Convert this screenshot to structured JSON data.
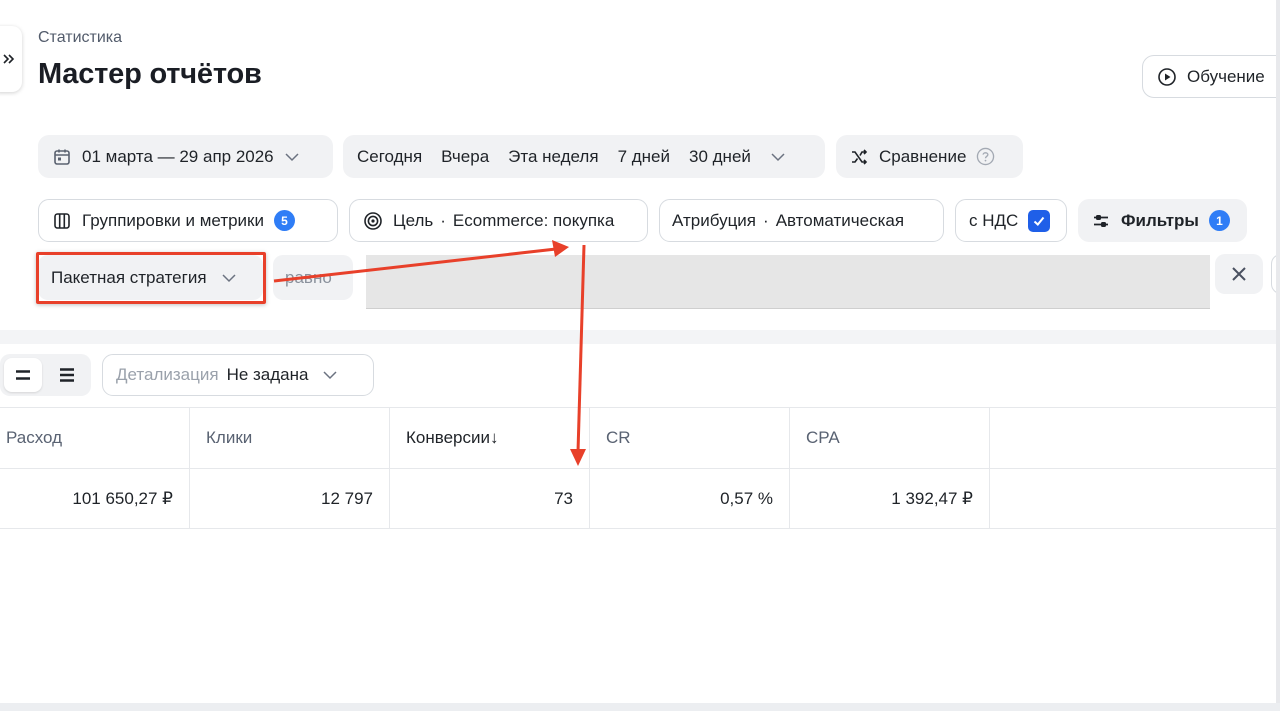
{
  "header": {
    "breadcrumb": "Статистика",
    "title": "Мастер отчётов",
    "tutorial_label": "Обучение"
  },
  "period": {
    "date_range": "01 марта — 29 апр 2026",
    "quick_ranges": [
      "Сегодня",
      "Вчера",
      "Эта неделя",
      "7 дней",
      "30 дней"
    ],
    "compare_label": "Сравнение"
  },
  "settings": {
    "groups_label": "Группировки и метрики",
    "groups_count": "5",
    "goal_label": "Цель",
    "goal_value": "Ecommerce: покупка",
    "attribution_label": "Атрибуция",
    "attribution_value": "Автоматическая",
    "vat_label": "с НДС",
    "vat_checked": true,
    "filters_label": "Фильтры",
    "filters_count": "1",
    "separator": "·"
  },
  "filter": {
    "field": "Пакетная стратегия",
    "operator": "равно"
  },
  "view": {
    "detail_label": "Детализация",
    "detail_value": "Не задана"
  },
  "table": {
    "columns": [
      "Расход",
      "Клики",
      "Конверсии",
      "CR",
      "CPA"
    ],
    "sort_indicator": "↓",
    "rows": [
      [
        "101 650,27 ₽",
        "12 797",
        "73",
        "0,57 %",
        "1 392,47 ₽"
      ]
    ]
  },
  "colors": {
    "accent": "#2f7df6",
    "annotation": "#e8402a",
    "pill_bg": "#f1f2f4"
  }
}
